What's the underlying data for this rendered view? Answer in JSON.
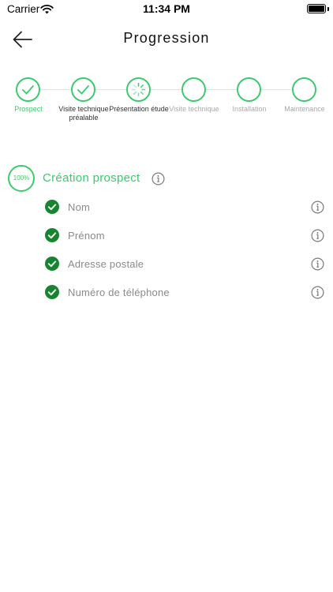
{
  "status_bar": {
    "carrier": "Carrier",
    "time": "11:34 PM"
  },
  "nav": {
    "title": "Progression"
  },
  "stepper": {
    "steps": [
      {
        "label": "Prospect",
        "state": "done",
        "label_style": "active"
      },
      {
        "label": "Visite technique préalable",
        "state": "done",
        "label_style": "dark"
      },
      {
        "label": "Présentation étude",
        "state": "in-progress",
        "label_style": "dark"
      },
      {
        "label": "Visite technique",
        "state": "pending",
        "label_style": "muted"
      },
      {
        "label": "Installation",
        "state": "pending",
        "label_style": "muted"
      },
      {
        "label": "Maintenance",
        "state": "pending",
        "label_style": "muted"
      }
    ]
  },
  "section": {
    "progress_percent": 100,
    "progress_label": "100%",
    "title": "Création prospect",
    "fields": [
      {
        "label": "Nom",
        "completed": true
      },
      {
        "label": "Prénom",
        "completed": true
      },
      {
        "label": "Adresse postale",
        "completed": true
      },
      {
        "label": "Numéro de téléphone",
        "completed": true
      }
    ]
  },
  "colors": {
    "accent": "#3ccb6c",
    "check_fill": "#17852f",
    "muted_text": "#8a8a8a"
  },
  "icons": {
    "back": "arrow-left-icon",
    "info": "info-circle-icon",
    "check": "check-icon",
    "spinner": "loading-spinner-icon"
  }
}
